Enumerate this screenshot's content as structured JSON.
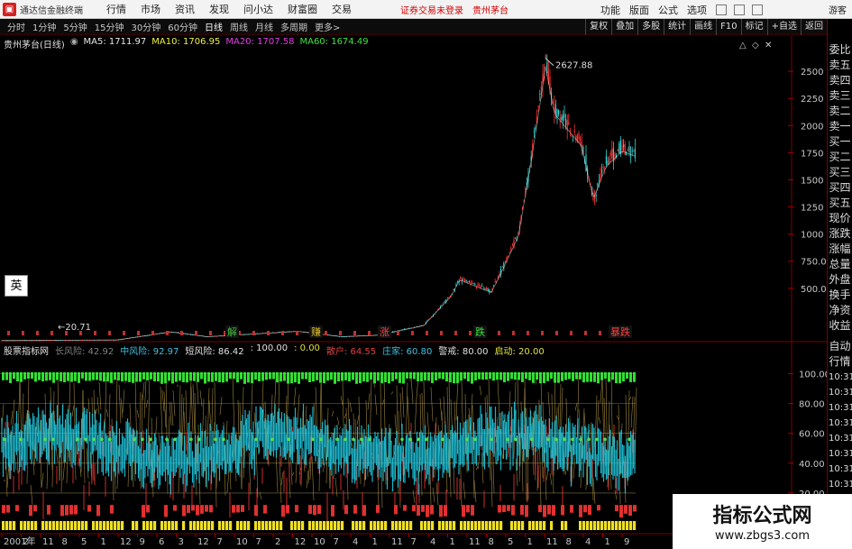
{
  "menubar": {
    "app_title": "通达信金融终端",
    "items": [
      "行情",
      "市场",
      "资讯",
      "发现",
      "问小达",
      "财富圈",
      "交易"
    ],
    "notice": "证券交易未登录",
    "stock": "贵州茅台",
    "right_items": [
      "功能",
      "版面",
      "公式",
      "选项"
    ],
    "guest": "游客"
  },
  "toolbar": {
    "timeframes": [
      "分时",
      "1分钟",
      "5分钟",
      "15分钟",
      "30分钟",
      "60分钟",
      "日线",
      "周线",
      "月线",
      "多周期",
      "更多>"
    ],
    "active": "日线",
    "right_buttons": [
      "复权",
      "叠加",
      "多股",
      "统计",
      "画线",
      "F10",
      "标记",
      "+自选",
      "返回"
    ]
  },
  "chart_main": {
    "stock_label": "贵州茅台(日线)",
    "ma": [
      {
        "label": "MA5: 1711.97",
        "color": "#e8e8e8"
      },
      {
        "label": "MA10: 1706.95",
        "color": "#f0f040"
      },
      {
        "label": "MA20: 1707.58",
        "color": "#e040e0"
      },
      {
        "label": "MA60: 1674.49",
        "color": "#40e040"
      }
    ],
    "y_ticks": [
      "2500",
      "2250",
      "2000",
      "1750",
      "1500",
      "1250",
      "1000",
      "750.00",
      "500.00"
    ],
    "max_label": "2627.88",
    "min_label": "20.71",
    "signal_labels": [
      "解",
      "赚",
      "涨",
      "跌",
      "暴跌"
    ]
  },
  "indicator": {
    "name": "股票指标网",
    "values": [
      {
        "label": "长风险: 42.92",
        "color": "#808080"
      },
      {
        "label": "中风险: 92.97",
        "color": "#40c0e0"
      },
      {
        "label": "短风险: 86.42",
        "color": "#e0e0e0"
      },
      {
        "label": ": 100.00",
        "color": "#e0e0e0"
      },
      {
        "label": ": 0.00",
        "color": "#e0e040"
      },
      {
        "label": "散户: 64.55",
        "color": "#e04040"
      },
      {
        "label": "庄家: 60.80",
        "color": "#40c0e0"
      },
      {
        "label": "警戒: 80.00",
        "color": "#e0e0e0"
      },
      {
        "label": "启动: 20.00",
        "color": "#e0e040"
      }
    ],
    "y_ticks": [
      "100.00",
      "80.00",
      "60.00",
      "40.00",
      "20.00"
    ]
  },
  "x_axis": {
    "labels": [
      "2001年",
      "2",
      "11",
      "8",
      "5",
      "1",
      "12",
      "9",
      "6",
      "3",
      "12",
      "7",
      "10",
      "7",
      "2",
      "12",
      "10",
      "7",
      "4",
      "1",
      "11",
      "7",
      "4",
      "1",
      "11",
      "8",
      "5",
      "1",
      "11",
      "8",
      "4",
      "1",
      "9"
    ]
  },
  "right_panel": {
    "items": [
      "委比",
      "卖五",
      "卖四",
      "卖三",
      "卖二",
      "卖一",
      "买一",
      "买二",
      "买三",
      "买四",
      "买五",
      "现价",
      "涨跌",
      "涨幅",
      "总量",
      "外盘",
      "换手",
      "净资",
      "收益"
    ],
    "bottom_items": [
      "自动",
      "行情",
      "10:31",
      "10:31",
      "10:31",
      "10:31",
      "10:31",
      "10:31",
      "10:31",
      "10:31",
      "10:31",
      "10:31"
    ]
  },
  "overlays": {
    "badge": "英",
    "watermark_title": "指标公式网",
    "watermark_url": "www.zbgs3.com"
  },
  "colors": {
    "up": "#ff3030",
    "down": "#30d0d0",
    "bar_green": "#30e030",
    "bar_yellow": "#f0e020",
    "ind_cyan": "#20c8e0",
    "ind_gold": "#d0b050"
  }
}
